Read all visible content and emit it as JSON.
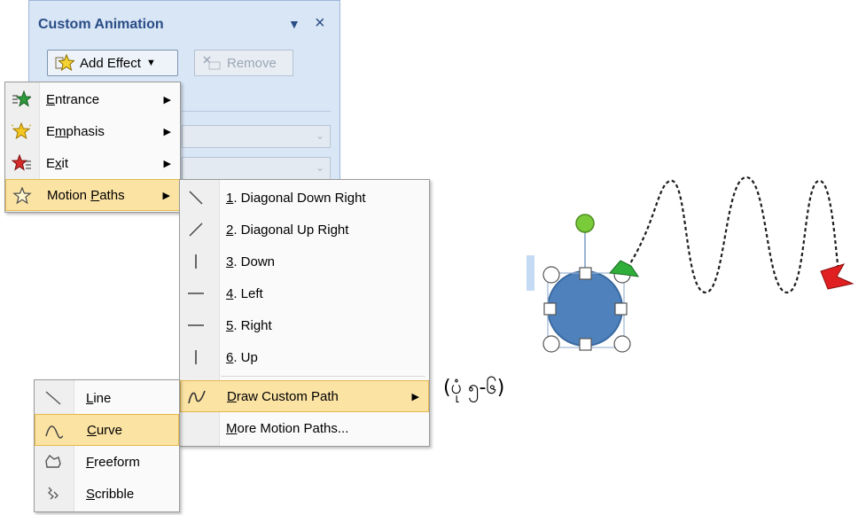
{
  "task_pane": {
    "title": "Custom Animation",
    "add_effect_label": "Add Effect",
    "remove_label": "Remove",
    "dropdown_glyph": "▼",
    "close_glyph": "×"
  },
  "effect_menu": {
    "items": [
      {
        "pre": "",
        "key": "E",
        "post": "ntrance",
        "icon": "entrance-star-icon"
      },
      {
        "pre": "E",
        "key": "m",
        "post": "phasis",
        "icon": "emphasis-star-icon"
      },
      {
        "pre": "E",
        "key": "x",
        "post": "it",
        "icon": "exit-star-icon"
      },
      {
        "pre": "Motion ",
        "key": "P",
        "post": "aths",
        "icon": "motion-path-star-icon"
      }
    ]
  },
  "motion_paths_menu": {
    "items": [
      {
        "key": "1",
        "post": ". Diagonal Down Right",
        "icon": "diagonal-down-right-icon"
      },
      {
        "key": "2",
        "post": ". Diagonal Up Right",
        "icon": "diagonal-up-right-icon"
      },
      {
        "key": "3",
        "post": ". Down",
        "icon": "down-line-icon"
      },
      {
        "key": "4",
        "post": ". Left",
        "icon": "left-line-icon"
      },
      {
        "key": "5",
        "post": ". Right",
        "icon": "right-line-icon"
      },
      {
        "key": "6",
        "post": ". Up",
        "icon": "up-line-icon"
      },
      {
        "key": "D",
        "post": "raw Custom Path",
        "icon": "custom-path-icon"
      },
      {
        "key": "M",
        "post": "ore Motion Paths...",
        "icon": ""
      }
    ]
  },
  "custom_path_menu": {
    "items": [
      {
        "key": "L",
        "post": "ine",
        "icon": "line-tool-icon"
      },
      {
        "key": "C",
        "post": "urve",
        "icon": "curve-tool-icon"
      },
      {
        "key": "F",
        "post": "reeform",
        "icon": "freeform-tool-icon"
      },
      {
        "key": "S",
        "post": "cribble",
        "icon": "scribble-tool-icon"
      }
    ]
  },
  "caption": "(ပုံ ၅-၆)",
  "colors": {
    "pane_bg": "#d8e6f6",
    "pane_title": "#2a4d86",
    "highlight": "#fbe3a4",
    "shape_fill": "#4f81bd",
    "rotation_handle": "#7acb3a",
    "start_marker": "#2fae3a",
    "end_marker": "#e02020"
  }
}
